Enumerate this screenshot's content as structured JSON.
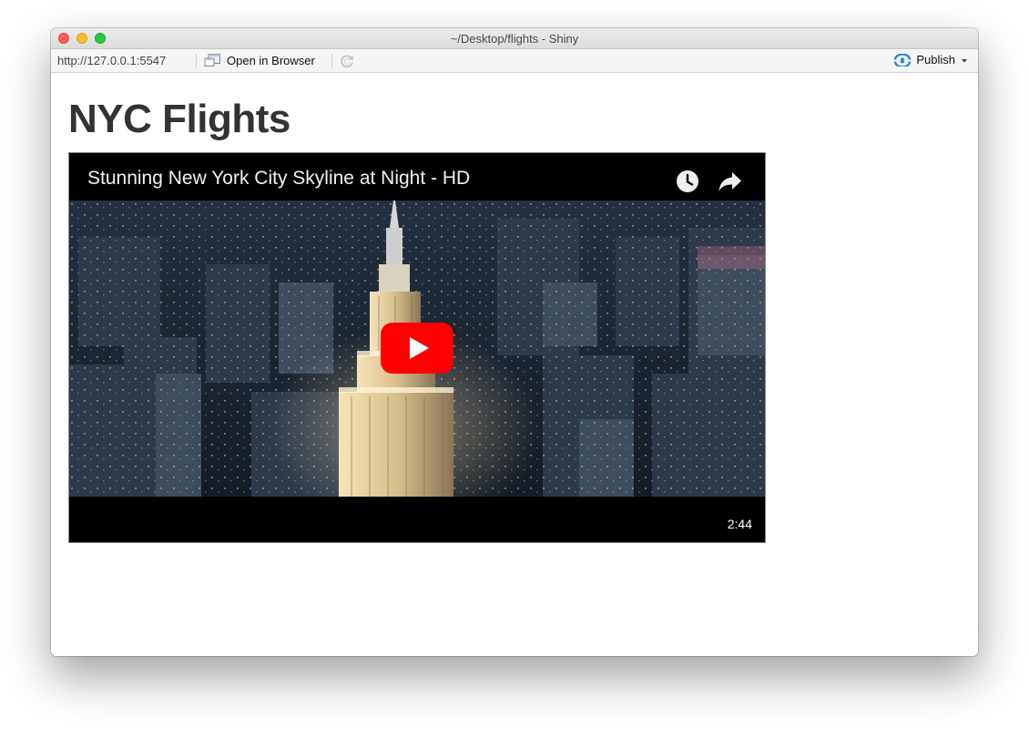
{
  "window": {
    "title": "~/Desktop/flights - Shiny"
  },
  "toolbar": {
    "url": "http://127.0.0.1:5547",
    "open_label": "Open in Browser",
    "publish_label": "Publish"
  },
  "page": {
    "title": "NYC Flights"
  },
  "video": {
    "title": "Stunning New York City Skyline at Night - HD",
    "duration": "2:44"
  },
  "colors": {
    "youtube_red": "#ff0000",
    "publish_blue": "#2a8dd4"
  },
  "icons": [
    "close-light",
    "minimize-light",
    "zoom-light",
    "browser-icon",
    "refresh-icon",
    "publish-icon",
    "chevron-down-icon",
    "clock-icon",
    "share-icon",
    "play-icon"
  ]
}
